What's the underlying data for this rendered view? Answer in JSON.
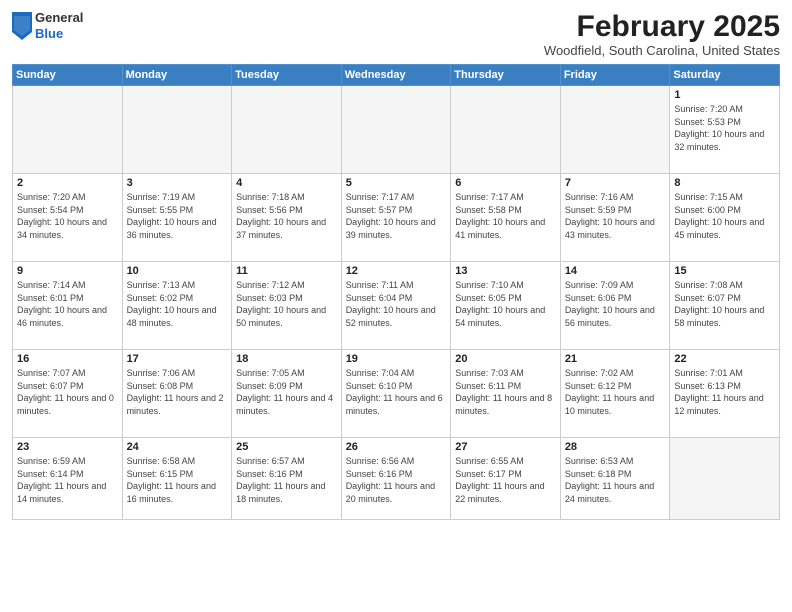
{
  "header": {
    "logo": {
      "general": "General",
      "blue": "Blue"
    },
    "title": "February 2025",
    "location": "Woodfield, South Carolina, United States"
  },
  "calendar": {
    "days_of_week": [
      "Sunday",
      "Monday",
      "Tuesday",
      "Wednesday",
      "Thursday",
      "Friday",
      "Saturday"
    ],
    "weeks": [
      [
        {
          "day": "",
          "info": ""
        },
        {
          "day": "",
          "info": ""
        },
        {
          "day": "",
          "info": ""
        },
        {
          "day": "",
          "info": ""
        },
        {
          "day": "",
          "info": ""
        },
        {
          "day": "",
          "info": ""
        },
        {
          "day": "1",
          "info": "Sunrise: 7:20 AM\nSunset: 5:53 PM\nDaylight: 10 hours and 32 minutes."
        }
      ],
      [
        {
          "day": "2",
          "info": "Sunrise: 7:20 AM\nSunset: 5:54 PM\nDaylight: 10 hours and 34 minutes."
        },
        {
          "day": "3",
          "info": "Sunrise: 7:19 AM\nSunset: 5:55 PM\nDaylight: 10 hours and 36 minutes."
        },
        {
          "day": "4",
          "info": "Sunrise: 7:18 AM\nSunset: 5:56 PM\nDaylight: 10 hours and 37 minutes."
        },
        {
          "day": "5",
          "info": "Sunrise: 7:17 AM\nSunset: 5:57 PM\nDaylight: 10 hours and 39 minutes."
        },
        {
          "day": "6",
          "info": "Sunrise: 7:17 AM\nSunset: 5:58 PM\nDaylight: 10 hours and 41 minutes."
        },
        {
          "day": "7",
          "info": "Sunrise: 7:16 AM\nSunset: 5:59 PM\nDaylight: 10 hours and 43 minutes."
        },
        {
          "day": "8",
          "info": "Sunrise: 7:15 AM\nSunset: 6:00 PM\nDaylight: 10 hours and 45 minutes."
        }
      ],
      [
        {
          "day": "9",
          "info": "Sunrise: 7:14 AM\nSunset: 6:01 PM\nDaylight: 10 hours and 46 minutes."
        },
        {
          "day": "10",
          "info": "Sunrise: 7:13 AM\nSunset: 6:02 PM\nDaylight: 10 hours and 48 minutes."
        },
        {
          "day": "11",
          "info": "Sunrise: 7:12 AM\nSunset: 6:03 PM\nDaylight: 10 hours and 50 minutes."
        },
        {
          "day": "12",
          "info": "Sunrise: 7:11 AM\nSunset: 6:04 PM\nDaylight: 10 hours and 52 minutes."
        },
        {
          "day": "13",
          "info": "Sunrise: 7:10 AM\nSunset: 6:05 PM\nDaylight: 10 hours and 54 minutes."
        },
        {
          "day": "14",
          "info": "Sunrise: 7:09 AM\nSunset: 6:06 PM\nDaylight: 10 hours and 56 minutes."
        },
        {
          "day": "15",
          "info": "Sunrise: 7:08 AM\nSunset: 6:07 PM\nDaylight: 10 hours and 58 minutes."
        }
      ],
      [
        {
          "day": "16",
          "info": "Sunrise: 7:07 AM\nSunset: 6:07 PM\nDaylight: 11 hours and 0 minutes."
        },
        {
          "day": "17",
          "info": "Sunrise: 7:06 AM\nSunset: 6:08 PM\nDaylight: 11 hours and 2 minutes."
        },
        {
          "day": "18",
          "info": "Sunrise: 7:05 AM\nSunset: 6:09 PM\nDaylight: 11 hours and 4 minutes."
        },
        {
          "day": "19",
          "info": "Sunrise: 7:04 AM\nSunset: 6:10 PM\nDaylight: 11 hours and 6 minutes."
        },
        {
          "day": "20",
          "info": "Sunrise: 7:03 AM\nSunset: 6:11 PM\nDaylight: 11 hours and 8 minutes."
        },
        {
          "day": "21",
          "info": "Sunrise: 7:02 AM\nSunset: 6:12 PM\nDaylight: 11 hours and 10 minutes."
        },
        {
          "day": "22",
          "info": "Sunrise: 7:01 AM\nSunset: 6:13 PM\nDaylight: 11 hours and 12 minutes."
        }
      ],
      [
        {
          "day": "23",
          "info": "Sunrise: 6:59 AM\nSunset: 6:14 PM\nDaylight: 11 hours and 14 minutes."
        },
        {
          "day": "24",
          "info": "Sunrise: 6:58 AM\nSunset: 6:15 PM\nDaylight: 11 hours and 16 minutes."
        },
        {
          "day": "25",
          "info": "Sunrise: 6:57 AM\nSunset: 6:16 PM\nDaylight: 11 hours and 18 minutes."
        },
        {
          "day": "26",
          "info": "Sunrise: 6:56 AM\nSunset: 6:16 PM\nDaylight: 11 hours and 20 minutes."
        },
        {
          "day": "27",
          "info": "Sunrise: 6:55 AM\nSunset: 6:17 PM\nDaylight: 11 hours and 22 minutes."
        },
        {
          "day": "28",
          "info": "Sunrise: 6:53 AM\nSunset: 6:18 PM\nDaylight: 11 hours and 24 minutes."
        },
        {
          "day": "",
          "info": ""
        }
      ]
    ]
  }
}
